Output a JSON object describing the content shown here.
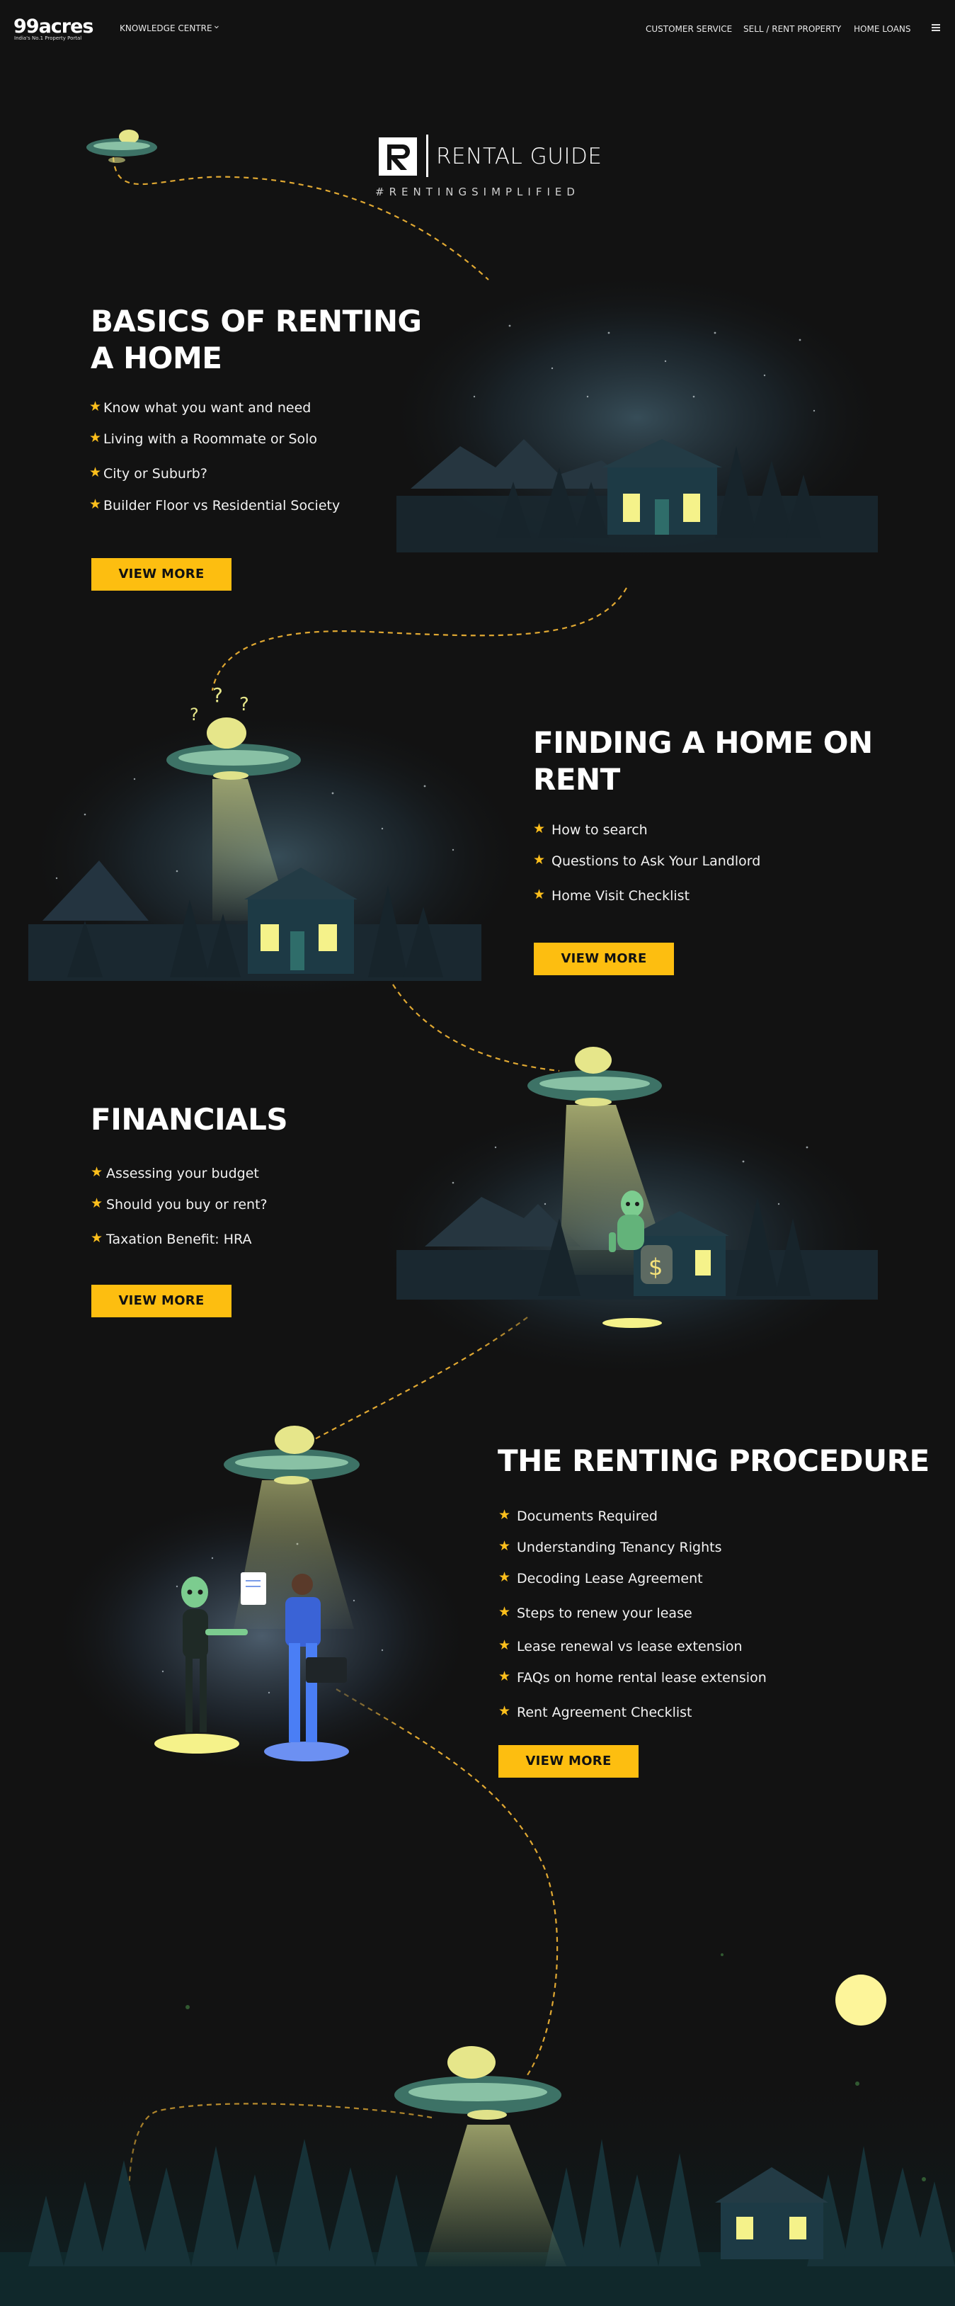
{
  "header": {
    "logo": "99acres",
    "logo_tagline": "India's No.1 Property Portal",
    "nav_left": "KNOWLEDGE CENTRE",
    "nav_right": [
      "CUSTOMER SERVICE",
      "SELL / RENT PROPERTY",
      "HOME LOANS"
    ]
  },
  "brand": {
    "name": "RENTAL GUIDE",
    "tagline": "#RENTINGSIMPLIFIED"
  },
  "sections": [
    {
      "title_lines": [
        "BASICS OF RENTING",
        "A HOME"
      ],
      "items": [
        "Know what you want and need",
        "Living with a Roommate or Solo",
        "City or Suburb?",
        "Builder Floor vs Residential Society"
      ],
      "button": "VIEW MORE"
    },
    {
      "title_lines": [
        "FINDING A HOME ON",
        "RENT"
      ],
      "items": [
        "How to search",
        "Questions to Ask Your Landlord",
        "Home Visit Checklist"
      ],
      "button": "VIEW MORE"
    },
    {
      "title_lines": [
        "FINANCIALS"
      ],
      "items": [
        "Assessing your budget",
        "Should you buy or rent?",
        "Taxation Benefit: HRA"
      ],
      "button": "VIEW MORE"
    },
    {
      "title_lines": [
        "THE RENTING PROCEDURE"
      ],
      "items": [
        "Documents Required",
        "Understanding Tenancy Rights",
        "Decoding Lease Agreement",
        "Steps to renew your lease",
        "Lease renewal vs lease extension",
        "FAQs on home rental lease extension",
        "Rent Agreement Checklist"
      ],
      "button": "VIEW MORE"
    }
  ],
  "illustrations": {
    "question_marks": [
      "?",
      "?",
      "?"
    ],
    "money_symbol": "$"
  },
  "icons": [
    "star-icon",
    "chevron-down-icon",
    "hamburger-menu-icon",
    "ufo-icon",
    "house-icon",
    "alien-icon",
    "moon-icon"
  ],
  "colors": {
    "background": "#121212",
    "accent_yellow": "#fdbe10",
    "star": "#fdbf1c",
    "ufo_green": "#7fb59a",
    "house_teal": "#1d3a45",
    "moon": "#fdf59a"
  }
}
